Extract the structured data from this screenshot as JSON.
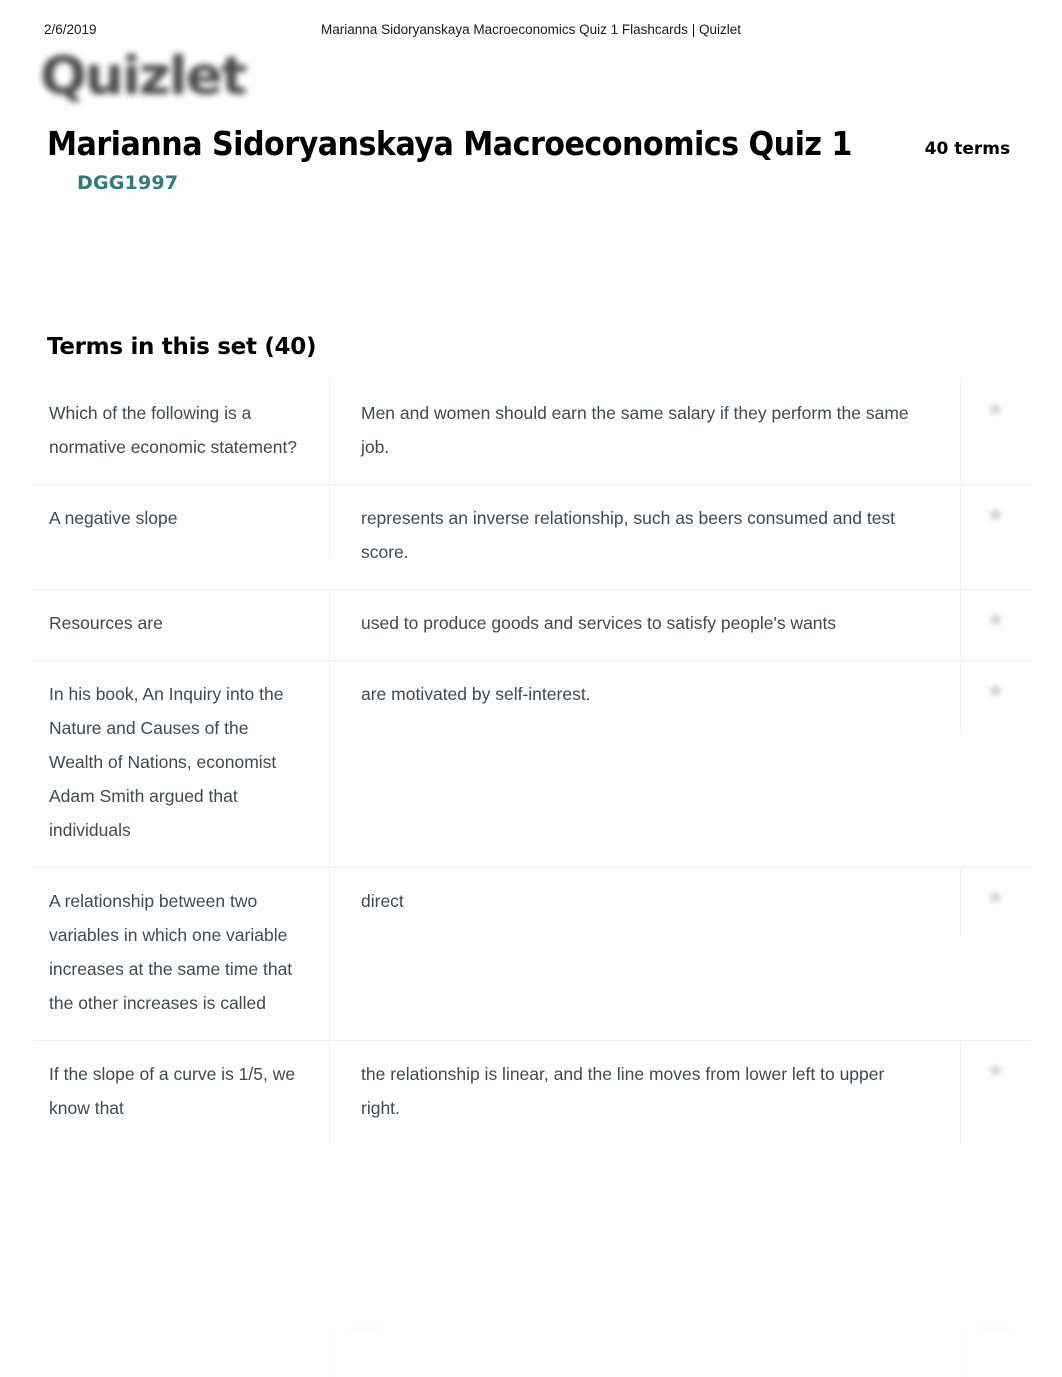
{
  "print_header": {
    "date": "2/6/2019",
    "document_title": "Marianna Sidoryanskaya Macroeconomics Quiz 1 Flashcards | Quizlet"
  },
  "brand": {
    "logo_text": "Quizlet",
    "logo_icon": "quizlet-wordmark"
  },
  "set": {
    "title": "Marianna Sidoryanskaya Macroeconomics Quiz 1",
    "term_count_label": "40 terms",
    "author": "DGG1997",
    "author_color": "#2e7d7d"
  },
  "terms_section": {
    "heading": "Terms in this set (40)",
    "star_icon": "star-icon",
    "rows": [
      {
        "term": "Which of the following is a normative economic statement?",
        "definition": "Men and women should earn the same salary if they perform the same job."
      },
      {
        "term": "A negative slope",
        "definition": "represents an inverse relationship, such as beers consumed and test score."
      },
      {
        "term": "Resources are",
        "definition": "used to produce goods and services to satisfy people's wants"
      },
      {
        "term": "In his book, An Inquiry into the Nature and Causes of the Wealth of Nations, economist Adam Smith argued that individuals",
        "definition": "are motivated by self-interest."
      },
      {
        "term": "A relationship between two variables in which one variable increases at the same time that the other increases is called",
        "definition": "direct"
      },
      {
        "term": "If the slope of a curve is 1/5, we know that",
        "definition": "the relationship is linear, and the line moves from lower left to upper right."
      }
    ]
  }
}
